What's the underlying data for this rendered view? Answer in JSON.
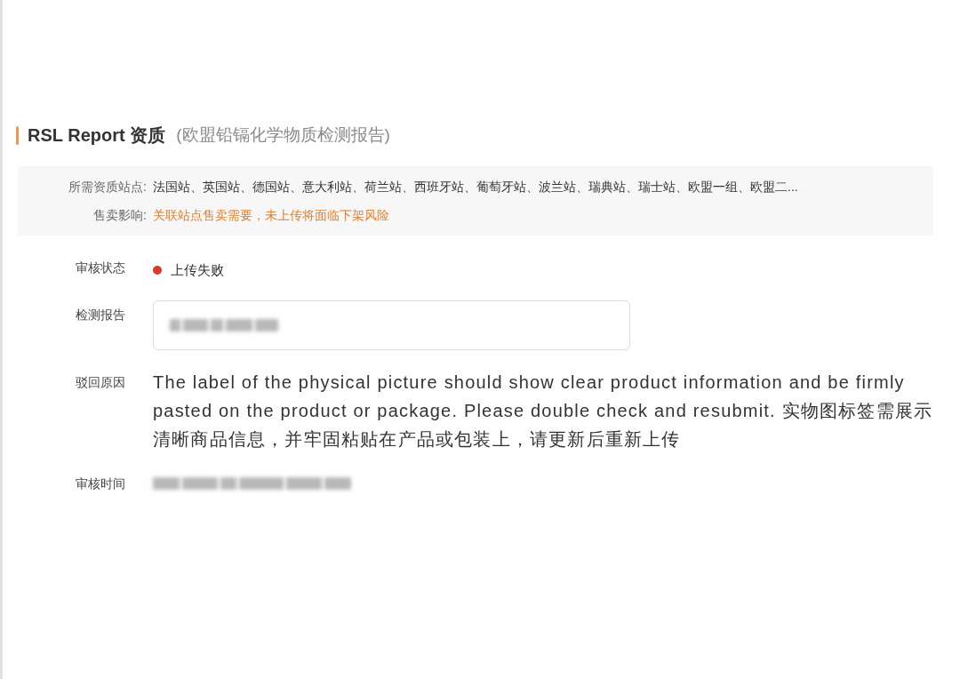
{
  "section": {
    "title": "RSL Report 资质",
    "subtitle": "(欧盟铅镉化学物质检测报告)"
  },
  "notice": [
    {
      "label": "所需资质站点:",
      "value": "法国站、英国站、德国站、意大利站、荷兰站、西班牙站、葡萄牙站、波兰站、瑞典站、瑞士站、欧盟一组、欧盟二...",
      "kind": "plain"
    },
    {
      "label": "售卖影响:",
      "value": "关联站点售卖需要，未上传将面临下架风险",
      "kind": "warning"
    }
  ],
  "fields": [
    {
      "label": "审核状态",
      "kind": "status",
      "value": "上传失败",
      "color": "#d93a2b"
    },
    {
      "label": "检测报告",
      "kind": "file"
    },
    {
      "label": "驳回原因",
      "kind": "text",
      "value": "The label of the physical picture should show clear product information and be firmly pasted on the product or package. Please double check and resubmit. 实物图标签需展示清晰商品信息，并牢固粘贴在产品或包装上，请更新后重新上传"
    },
    {
      "label": "审核时间",
      "kind": "redacted"
    }
  ]
}
